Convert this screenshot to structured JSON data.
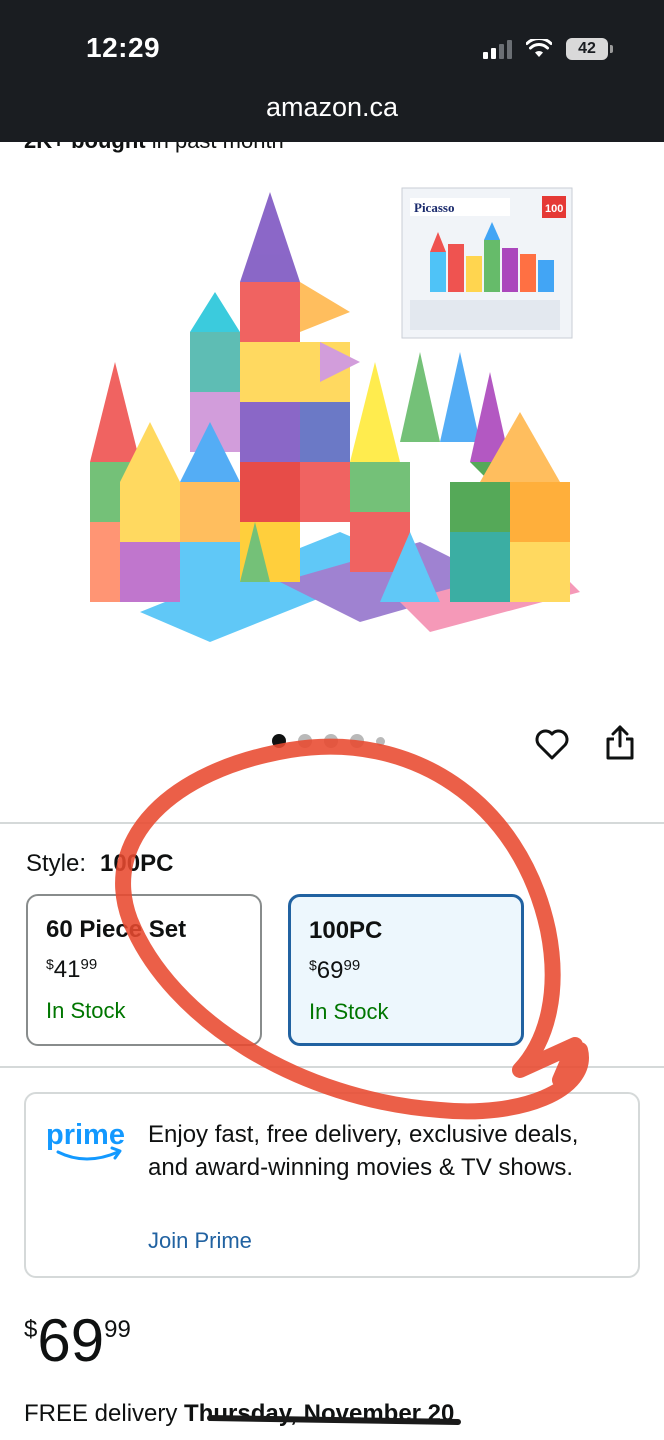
{
  "status_bar": {
    "time": "12:29",
    "battery": "42"
  },
  "browser": {
    "url": "amazon.ca"
  },
  "product": {
    "bought_bold": "2K+ bought",
    "bought_rest": " in past month",
    "image_box_brand": "Picasso",
    "image_box_count": "100"
  },
  "carousel": {
    "dot_count": 5,
    "active_index": 0
  },
  "style_selector": {
    "label": "Style:",
    "selected": "100PC",
    "options": [
      {
        "name": "60 Piece Set",
        "currency": "$",
        "whole": "41",
        "cents": "99",
        "stock": "In Stock",
        "selected": false
      },
      {
        "name": "100PC",
        "currency": "$",
        "whole": "69",
        "cents": "99",
        "stock": "In Stock",
        "selected": true
      }
    ]
  },
  "prime": {
    "logo_text": "prime",
    "message": "Enjoy fast, free delivery, exclusive deals, and award-winning movies & TV shows.",
    "link": "Join Prime"
  },
  "price": {
    "currency": "$",
    "whole": "69",
    "cents": "99"
  },
  "delivery": {
    "prefix": "FREE delivery ",
    "date": "Thursday, November 20"
  },
  "colors": {
    "accent_blue": "#2162a1",
    "stock_green": "#007600",
    "annotation_red": "#e8492f"
  }
}
